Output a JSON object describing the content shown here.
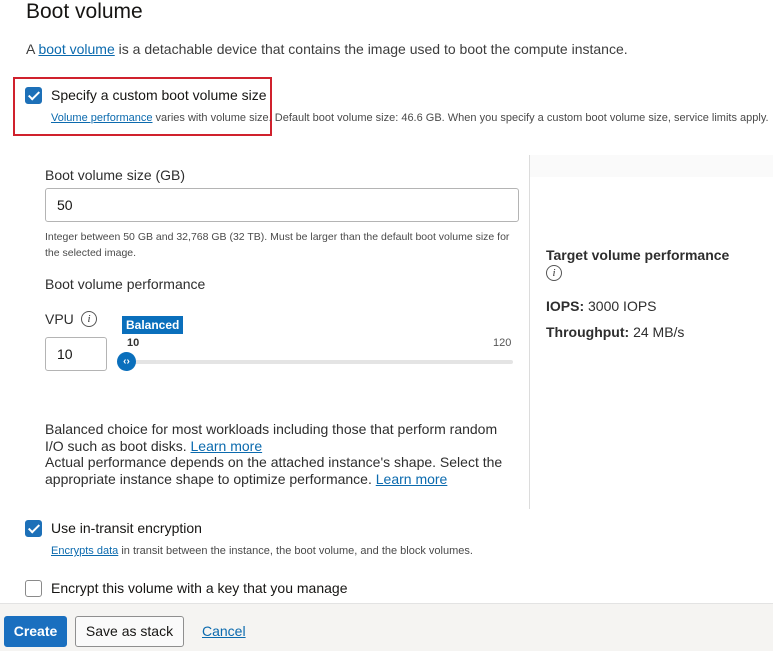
{
  "section": {
    "title": "Boot volume",
    "intro_prefix": "A ",
    "intro_link": "boot volume",
    "intro_suffix": " is a detachable device that contains the image used to boot the compute instance."
  },
  "custom_size": {
    "checked": true,
    "label": "Specify a custom boot volume size",
    "help_link": "Volume performance",
    "help_text": " varies with volume size. Default boot volume size: 46.6 GB. When you specify a custom boot volume size, service limits apply."
  },
  "size_field": {
    "label": "Boot volume size (GB)",
    "value": "50",
    "hint": "Integer between 50 GB and 32,768 GB (32 TB). Must be larger than the default boot volume size for the selected image."
  },
  "performance": {
    "label": "Boot volume performance",
    "vpu_label": "VPU",
    "vpu_value": "10",
    "slider_badge": "Balanced",
    "slider_min": "10",
    "slider_max": "120",
    "slider_thumb_glyph": "‹›",
    "desc_line1": "Balanced choice for most workloads including those that perform random I/O such as boot disks. ",
    "desc_link1": "Learn more",
    "desc_line2": "Actual performance depends on the attached instance's shape. Select the appropriate instance shape to optimize performance. ",
    "desc_link2": "Learn more"
  },
  "target": {
    "title": "Target volume performance",
    "iops_label": "IOPS:",
    "iops_value": " 3000 IOPS",
    "throughput_label": "Throughput:",
    "throughput_value": " 24 MB/s"
  },
  "encryption": {
    "in_transit_checked": true,
    "in_transit_label": "Use in-transit encryption",
    "in_transit_help_link": "Encrypts data",
    "in_transit_help_text": " in transit between the instance, the boot volume, and the block volumes.",
    "own_key_checked": false,
    "own_key_label": "Encrypt this volume with a key that you manage"
  },
  "footer": {
    "create_label": "Create",
    "save_stack_label": "Save as stack",
    "cancel_label": "Cancel"
  },
  "info_icon_glyph": "i",
  "colors": {
    "accent": "#1a6fbf",
    "highlight_border": "#d0212d",
    "link": "#0b6aae"
  }
}
